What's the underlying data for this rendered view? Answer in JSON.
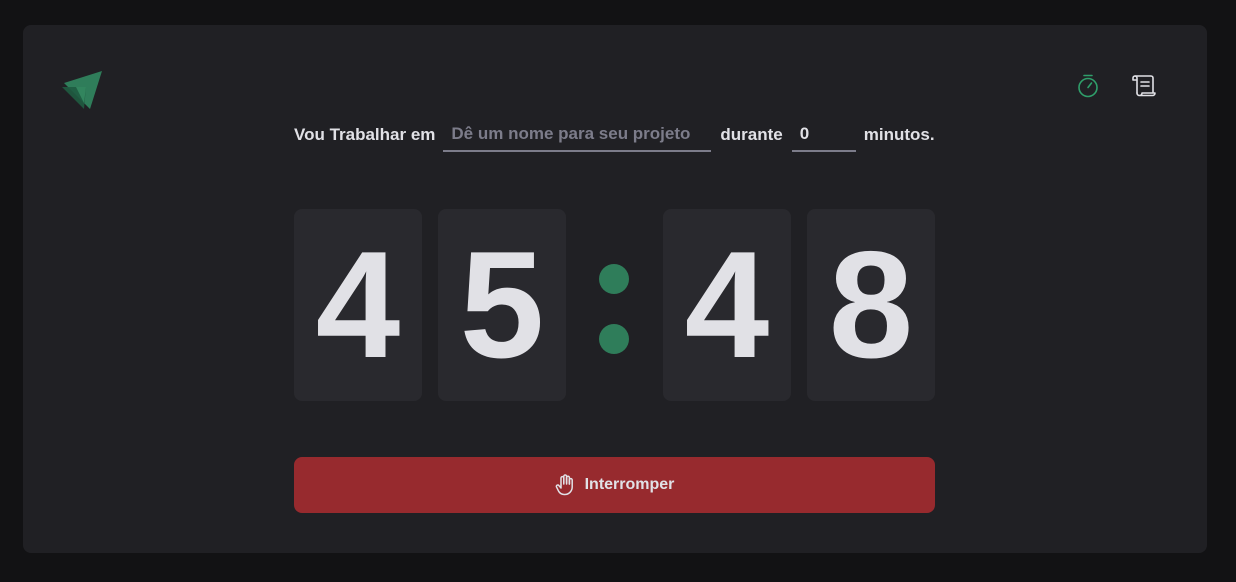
{
  "form": {
    "label_start": "Vou Trabalhar em",
    "task_placeholder": "Dê um nome para seu projeto",
    "task_value": "",
    "label_middle": "durante",
    "minutes_value": "0",
    "label_end": "minutos."
  },
  "countdown": {
    "minutes_tens": "4",
    "minutes_ones": "5",
    "seconds_tens": "4",
    "seconds_ones": "8"
  },
  "button": {
    "label": "Interromper"
  },
  "nav": {
    "timer_icon": "timer-icon",
    "history_icon": "scroll-icon"
  },
  "colors": {
    "background": "#121214",
    "panel": "#202024",
    "digit_bg": "#29292e",
    "text": "#e1e1e6",
    "accent_green": "#2f7d5a",
    "stop_red": "#972a2e",
    "placeholder": "#7c7c8a"
  }
}
